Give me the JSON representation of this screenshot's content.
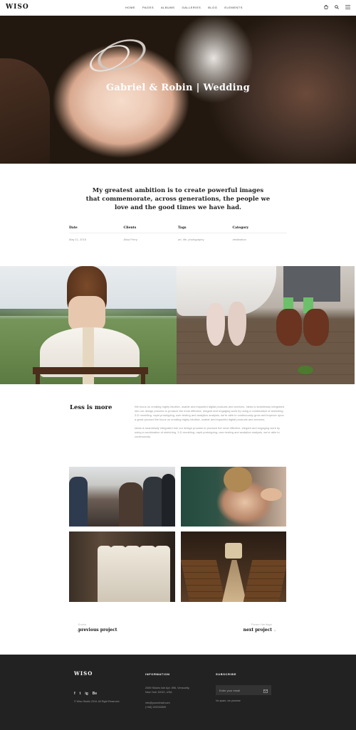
{
  "header": {
    "logo": "WISO",
    "nav": [
      "HOME",
      "PAGES",
      "ALBUMS",
      "GALLERIES",
      "BLOG",
      "ELEMENTS"
    ],
    "icons": [
      "cart-icon",
      "search-icon",
      "menu-icon"
    ]
  },
  "hero": {
    "title": "Gabriel & Robin | Wedding"
  },
  "quote": "My greatest ambition is to create powerful images that commemorate, across generations, the people we love and the good times we have had.",
  "meta": [
    {
      "label": "Date",
      "value": "May 11, 2018"
    },
    {
      "label": "Clients",
      "value": "Alisa Perry"
    },
    {
      "label": "Tags",
      "value": "art, life, photography"
    },
    {
      "label": "Category",
      "value": "destination"
    }
  ],
  "less": {
    "title": "Less is more",
    "p1": "We focus on creating highly intuitive, usable and impactful digital products and services. Ideas is seamlessly integrated into our design process to produce the most effective, elegant and engaging work by using a combination of sketching, 3-D modeling, rapid prototyping, user testing and analytics analysis, we're able to continuously grow and improve upon a great product We focus on creating highly intuitive, usable and impactful digital products and services.",
    "p2": "Ideas is seamlessly integrated into our design process to produce the most effective, elegant and engaging work by using a combination of sketching, 3-D modeling, rapid prototyping, user testing and analytics analysis, we're able to continuously"
  },
  "pager": {
    "prev_small": "Encho",
    "prev_label": "previous project",
    "next_small": "Flower Heritage",
    "next_label": "next project"
  },
  "footer": {
    "logo": "WISO",
    "social": [
      "f",
      "t",
      "ig",
      "Be"
    ],
    "copyright": "© Wiso Studio 2018. All Right Reserved.",
    "info_title": "INFORMATION",
    "address1": "2069 Stokes Isle Apt. 896, Vensuelty,",
    "address2": "New York 10010, USA",
    "email": "info@yourdmail.com",
    "phone": "(+68) 120034509",
    "subscribe_title": "SUBSCRIBE",
    "subscribe_placeholder": "Enter your email",
    "subscribe_note": "No spam, we promise"
  }
}
